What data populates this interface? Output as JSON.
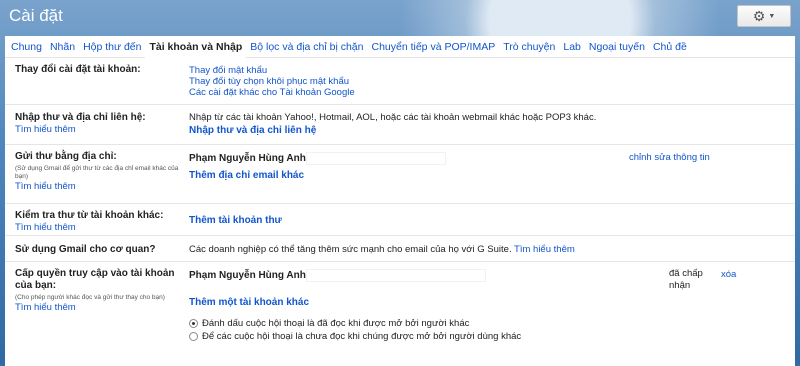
{
  "app": {
    "title": "Cài đặt"
  },
  "toolbar": {
    "settings_icon": "gear-icon",
    "chevron_icon": "chevron-down-icon"
  },
  "tabs": [
    {
      "label": "Chung",
      "active": false
    },
    {
      "label": "Nhãn",
      "active": false
    },
    {
      "label": "Hộp thư đến",
      "active": false
    },
    {
      "label": "Tài khoản và Nhập",
      "active": true
    },
    {
      "label": "Bộ lọc và địa chỉ bị chặn",
      "active": false
    },
    {
      "label": "Chuyển tiếp và POP/IMAP",
      "active": false
    },
    {
      "label": "Trò chuyện",
      "active": false
    },
    {
      "label": "Lab",
      "active": false
    },
    {
      "label": "Ngoại tuyến",
      "active": false
    },
    {
      "label": "Chủ đề",
      "active": false
    }
  ],
  "change_account": {
    "label": "Thay đổi cài đặt tài khoản:",
    "links": [
      "Thay đổi mật khẩu",
      "Thay đổi tùy chọn khôi phục mật khẩu",
      "Các cài đặt khác cho Tài khoản Google"
    ]
  },
  "import": {
    "label": "Nhập thư và địa chỉ liên hệ:",
    "learn_more": "Tìm hiểu thêm",
    "description": "Nhập từ các tài khoản Yahoo!, Hotmail, AOL, hoặc các tài khoản webmail khác hoặc POP3 khác.",
    "action": "Nhập thư và địa chỉ liên hệ"
  },
  "send_as": {
    "label": "Gửi thư bằng địa chỉ:",
    "sub": "(Sử dụng Gmail để gửi thư từ các địa chỉ email khác của bạn)",
    "learn_more": "Tìm hiểu thêm",
    "name": "Phạm Nguyễn Hùng Anh",
    "edit": "chỉnh sửa thông tin",
    "add": "Thêm địa chỉ email khác"
  },
  "check_mail": {
    "label": "Kiểm tra thư từ tài khoản khác:",
    "learn_more": "Tìm hiểu thêm",
    "add": "Thêm tài khoản thư"
  },
  "business": {
    "label": "Sử dụng Gmail cho cơ quan?",
    "description": "Các doanh nghiệp có thể tăng thêm sức mạnh cho email của họ với G Suite.",
    "learn_more": "Tìm hiểu thêm"
  },
  "grant": {
    "label": "Cấp quyền truy cập vào tài khoản của bạn:",
    "sub": "(Cho phép người khác đọc và gửi thư thay cho bạn)",
    "learn_more": "Tìm hiểu thêm",
    "name": "Phạm Nguyễn Hùng Anh",
    "status": "đã chấp nhận",
    "delete": "xóa",
    "add": "Thêm một tài khoản khác",
    "options": [
      {
        "label": "Đánh dấu cuộc hội thoại là đã đọc khi được mở bởi người khác",
        "checked": true
      },
      {
        "label": "Để các cuộc hội thoại là chưa đọc khi chúng được mở bởi người dùng khác",
        "checked": false
      }
    ]
  }
}
